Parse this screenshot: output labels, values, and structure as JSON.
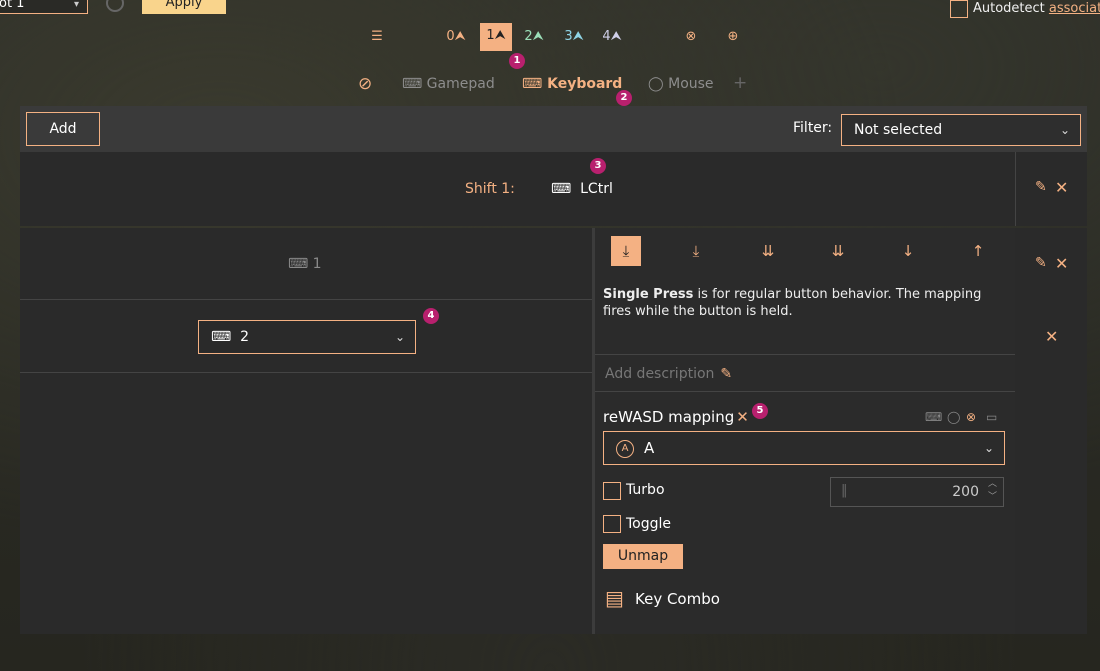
{
  "topbar": {
    "config_select_value": "ot 1",
    "apply_label": "Apply",
    "autodetect_label": "Autodetect ",
    "autodetect_link": "associate"
  },
  "shift_icons": {
    "items": [
      {
        "name": "list-icon",
        "glyph": "☰"
      },
      {
        "name": "shift-0-icon",
        "glyph": "0⮝"
      },
      {
        "name": "shift-1-icon",
        "glyph": "1⮝",
        "active": true
      },
      {
        "name": "shift-2-icon",
        "glyph": "2⮝"
      },
      {
        "name": "shift-3-icon",
        "glyph": "3⮝"
      },
      {
        "name": "shift-4-icon",
        "glyph": "4⮝"
      },
      {
        "name": "xbox-icon",
        "glyph": "⊗"
      },
      {
        "name": "add-controller-icon",
        "glyph": "⊕"
      }
    ]
  },
  "badges": [
    "1",
    "2",
    "3",
    "4",
    "5"
  ],
  "device_tabs": {
    "hidden_icon": "⊘",
    "gamepad": "Gamepad",
    "keyboard": "Keyboard",
    "mouse": "Mouse",
    "add": "+"
  },
  "toolbar": {
    "add_label": "Add",
    "filter_label": "Filter:",
    "filter_value": "Not selected"
  },
  "shift_row": {
    "label": "Shift 1:",
    "key": "LCtrl"
  },
  "mapping_rows": [
    {
      "key": "1"
    },
    {
      "key": "2"
    }
  ],
  "press_types": [
    {
      "name": "single-press-icon",
      "glyph": "⤓",
      "active": true
    },
    {
      "name": "long-press-icon",
      "glyph": "⤓"
    },
    {
      "name": "double-press-icon",
      "glyph": "⇊"
    },
    {
      "name": "triple-press-icon",
      "glyph": "⇊"
    },
    {
      "name": "start-press-icon",
      "glyph": "↓"
    },
    {
      "name": "release-icon",
      "glyph": "↑"
    }
  ],
  "description": {
    "bold": "Single Press",
    "text": " is for regular button behavior. The mapping fires while the button is held."
  },
  "add_description": "Add description",
  "rewasd": {
    "label": "reWASD mapping",
    "mapping_value": "A",
    "a_badge": "A"
  },
  "options": {
    "turbo_label": "Turbo",
    "turbo_value": "200",
    "toggle_label": "Toggle",
    "unmap_label": "Unmap",
    "key_combo_label": "Key Combo"
  },
  "colors": {
    "accent": "#f4b183",
    "badge": "#b8206e",
    "apply": "#f9d48c"
  }
}
